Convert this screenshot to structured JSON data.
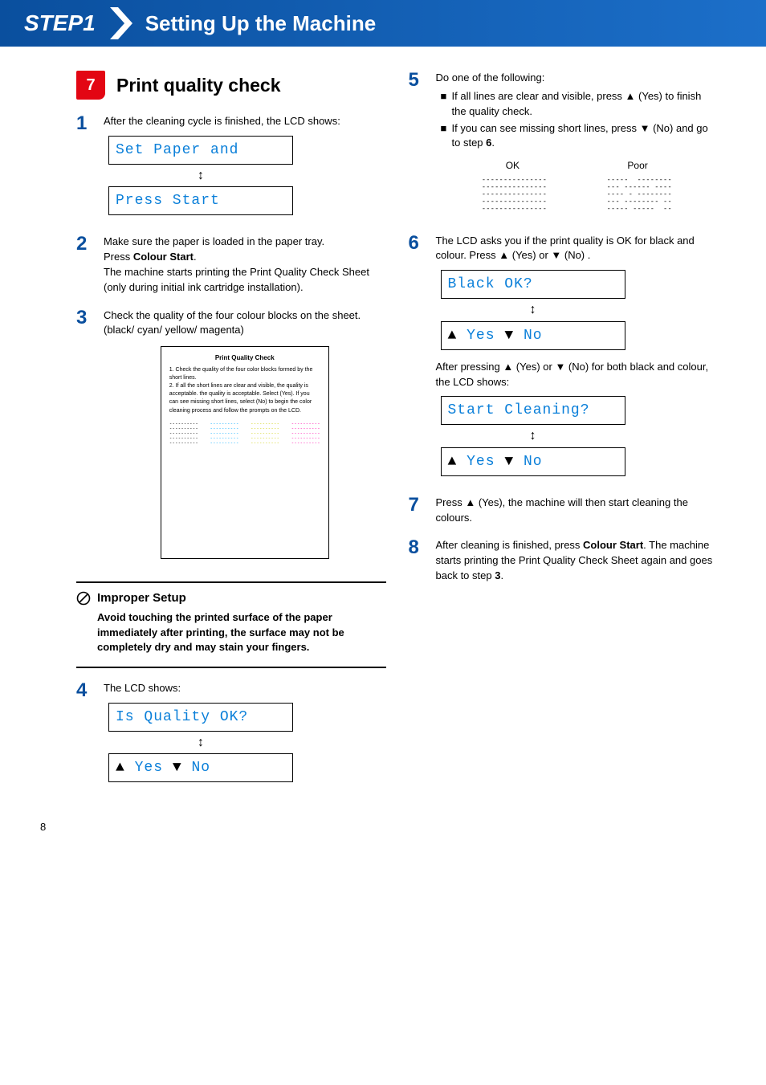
{
  "header": {
    "step": "STEP1",
    "title": "Setting Up the Machine"
  },
  "section": {
    "badge": "7",
    "title": "Print quality check"
  },
  "s1": {
    "num": "1",
    "text": "After the cleaning cycle is finished, the LCD shows:",
    "lcd1": "Set Paper and",
    "lcd2": "Press Start"
  },
  "s2": {
    "num": "2",
    "l1": "Make sure the paper is loaded in the paper tray.",
    "l2a": "Press ",
    "l2b": "Colour Start",
    "l2c": ".",
    "l3": "The machine starts printing the Print Quality Check Sheet (only during initial ink cartridge installation)."
  },
  "s3": {
    "num": "3",
    "l1": "Check the quality of the four colour blocks on the sheet.",
    "l2": "(black/ cyan/ yellow/ magenta)"
  },
  "sheet": {
    "title": "Print Quality Check",
    "li1": "1.  Check the quality of the four color blocks formed by the short lines.",
    "li2": "2.  If all the short lines are clear and visible, the quality is acceptable. the quality is acceptable. Select (Yes). If you can see missing short lines, select (No) to begin the color cleaning process and follow the prompts on the LCD."
  },
  "callout": {
    "title": "Improper Setup",
    "body": "Avoid touching the printed surface of the paper immediately after printing, the surface may not be completely dry and may stain your fingers."
  },
  "s4": {
    "num": "4",
    "text": "The LCD shows:",
    "lcd1": "Is Quality OK?",
    "lcd2_yes": " Yes ",
    "lcd2_no": " No"
  },
  "s5": {
    "num": "5",
    "intro": "Do one of the following:",
    "b1a": "If all lines are clear and visible, press ▲ (Yes)  to finish the quality check.",
    "b2a": "If you can see missing short lines, press ▼ (No) and go to step ",
    "b2b": "6",
    "b2c": ".",
    "ok": "OK",
    "poor": "Poor"
  },
  "s6": {
    "num": "6",
    "text": "The LCD asks you if the print quality is OK for black and colour. Press ▲ (Yes) or ▼ (No) .",
    "lcd1": "Black OK?",
    "lcd2_yes": " Yes ",
    "lcd2_no": " No",
    "after": "After pressing ▲ (Yes) or ▼ (No) for both black and colour, the LCD shows:",
    "lcd3": "Start Cleaning?",
    "lcd4_yes": " Yes ",
    "lcd4_no": " No"
  },
  "s7": {
    "num": "7",
    "text": "Press ▲ (Yes), the machine will then start cleaning the colours."
  },
  "s8": {
    "num": "8",
    "a": "After cleaning is finished, press ",
    "b": "Colour Start",
    "c": ". The machine starts printing the Print Quality Check Sheet again and goes back to step ",
    "d": "3",
    "e": "."
  },
  "pageNumber": "8"
}
